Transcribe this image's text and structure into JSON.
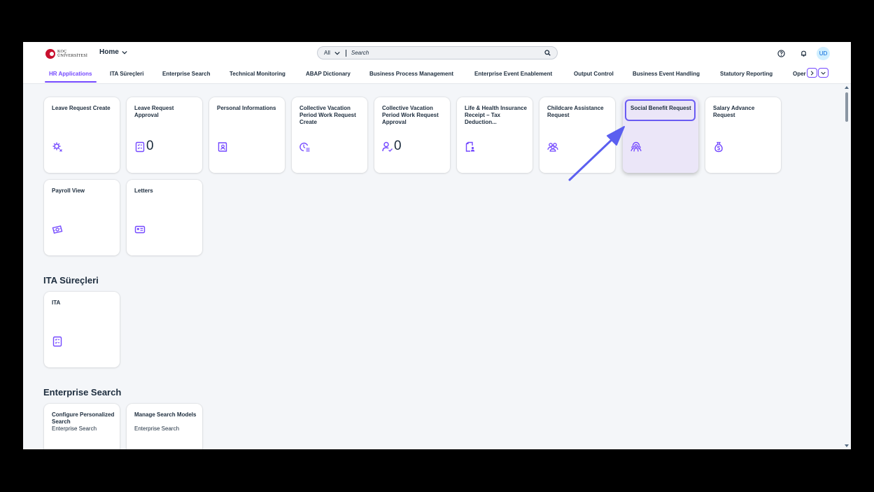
{
  "header": {
    "logo_line1": "KOÇ",
    "logo_line2": "ÜNİVERSİTESİ",
    "home_label": "Home",
    "search_scope": "All",
    "search_placeholder": "Search",
    "avatar_initials": "UD"
  },
  "tabs": [
    {
      "label": "HR Applications",
      "active": true
    },
    {
      "label": "ITA Süreçleri"
    },
    {
      "label": "Enterprise Search"
    },
    {
      "label": "Technical Monitoring"
    },
    {
      "label": "ABAP Dictionary"
    },
    {
      "label": "Business Process Management"
    },
    {
      "label": "Enterprise Event Enablement"
    },
    {
      "label": "Output Control"
    },
    {
      "label": "Business Event Handling"
    },
    {
      "label": "Statutory Reporting"
    },
    {
      "label": "Oper"
    }
  ],
  "sections": [
    {
      "title": "",
      "tiles": [
        {
          "title": "Leave Request Create",
          "icon": "leave-request-gear-icon"
        },
        {
          "title": "Leave Request Approval",
          "icon": "checklist-icon",
          "count": "0"
        },
        {
          "title": "Personal Informations",
          "icon": "personal-id-icon"
        },
        {
          "title": "Collective Vacation Period Work Request Create",
          "icon": "clock-list-icon"
        },
        {
          "title": "Collective Vacation Period Work Request Approval",
          "icon": "person-check-icon",
          "count": "0"
        },
        {
          "title": "Life & Health Insurance Receipt – Tax Deduction...",
          "icon": "document-person-icon"
        },
        {
          "title": "Childcare Assistance Request",
          "icon": "group-icon"
        },
        {
          "title": "Social Benefit Request",
          "icon": "social-group-icon",
          "selected": true
        },
        {
          "title": "Salary Advance Request",
          "icon": "money-bag-icon"
        },
        {
          "title": "Payroll View",
          "icon": "money-icon"
        },
        {
          "title": "Letters",
          "icon": "id-card-icon"
        }
      ]
    },
    {
      "title": "ITA Süreçleri",
      "tiles": [
        {
          "title": "ITA",
          "icon": "checklist-icon"
        }
      ]
    },
    {
      "title": "Enterprise Search",
      "tiles": [
        {
          "title": "Configure Personalized Search",
          "subtitle": "Enterprise Search",
          "icon": "search-config-icon"
        },
        {
          "title": "Manage Search Models",
          "subtitle": "Enterprise Search",
          "icon": "search-models-icon"
        }
      ]
    }
  ],
  "colors": {
    "accent": "#7449ff",
    "selected_tile": "#ebe6f8",
    "focus_ring": "#6a5cf2",
    "annotation_arrow": "#5b5ff0"
  }
}
